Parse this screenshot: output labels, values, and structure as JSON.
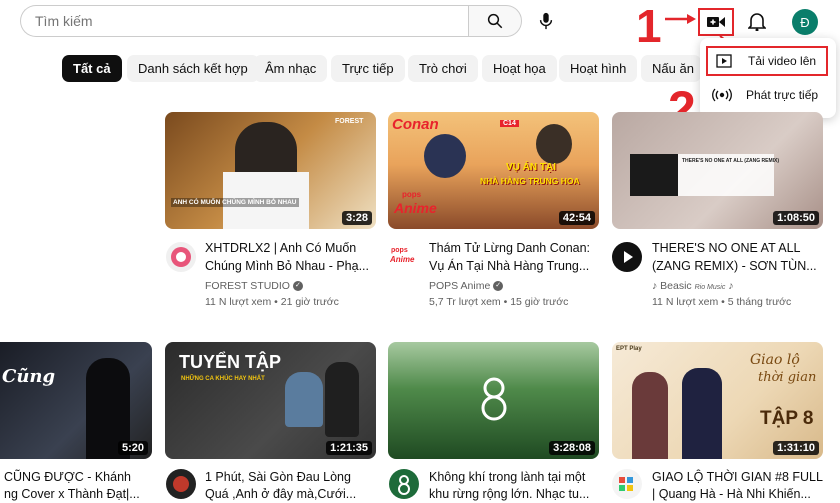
{
  "header": {
    "search_placeholder": "Tìm kiếm",
    "avatar_letter": "Đ",
    "annotation_1": "1",
    "annotation_2": "2"
  },
  "chips": [
    "Tất cả",
    "Danh sách kết hợp",
    "Âm nhạc",
    "Trực tiếp",
    "Trò chơi",
    "Hoạt họa",
    "Hoạt hình",
    "Nấu ăn"
  ],
  "create_menu": {
    "upload_label": "Tải video lên",
    "live_label": "Phát trực tiếp"
  },
  "videos": [
    {
      "title_1": "XHTDRLX2 | Anh Có Muốn",
      "title_2": "Chúng Mình Bỏ Nhau - Phạ...",
      "channel": "FOREST STUDIO",
      "stats": "11 N lượt xem • 21 giờ trước",
      "duration": "3:28",
      "overlay_a": "FOREST",
      "overlay_b": "ANH CÓ MUỐN CHÚNG MÌNH BỎ NHAU"
    },
    {
      "title_1": "Thám Tử Lừng Danh Conan:",
      "title_2": "Vụ Án Tại Nhà Hàng Trung...",
      "channel": "POPS Anime",
      "stats": "5,7 Tr lượt xem • 15 giờ trước",
      "duration": "42:54",
      "overlay_a": "Conan",
      "overlay_b": "C14",
      "overlay_c": "VỤ ÁN TẠI",
      "overlay_d": "NHÀ HÀNG TRUNG HOA",
      "overlay_e": "pops",
      "overlay_f": "Anime",
      "logo_text_1": "pops",
      "logo_text_2": "Anime"
    },
    {
      "title_1": "THERE'S NO ONE AT ALL",
      "title_2": "(ZANG REMIX) - SƠN TÙN...",
      "channel": "Beasic",
      "channel_extra": "Rio Music",
      "stats": "11 N lượt xem • 5 tháng trước",
      "duration": "1:08:50",
      "overlay_a": "THERE'S NO ONE AT ALL (ZANG REMIX)"
    },
    {
      "title_1": "CŨNG ĐƯỢC - Khánh",
      "title_2": "ng Cover x Thành Đạt|...",
      "duration": "5:20",
      "overlay_a": "Cũng"
    },
    {
      "title_1": "1 Phút, Sài Gòn Đau Lòng",
      "title_2": "Quá ,Anh ở đây mà,Cưới...",
      "duration": "1:21:35",
      "overlay_a": "TUYỂN TẬP",
      "overlay_b": "NHỮNG CA KHÚC HAY NHẤT"
    },
    {
      "title_1": "Không khí trong lành tại một",
      "title_2": "khu rừng rộng lớn. Nhạc tu...",
      "duration": "3:28:08"
    },
    {
      "title_1": "GIAO LỘ THỜI GIAN #8 FULL",
      "title_2": "| Quang Hà - Hà Nhi Khiến...",
      "duration": "1:31:10",
      "overlay_a": "Giao lộ",
      "overlay_b": "thời gian",
      "overlay_c": "TẬP 8",
      "overlay_d": "EPT Play"
    }
  ]
}
